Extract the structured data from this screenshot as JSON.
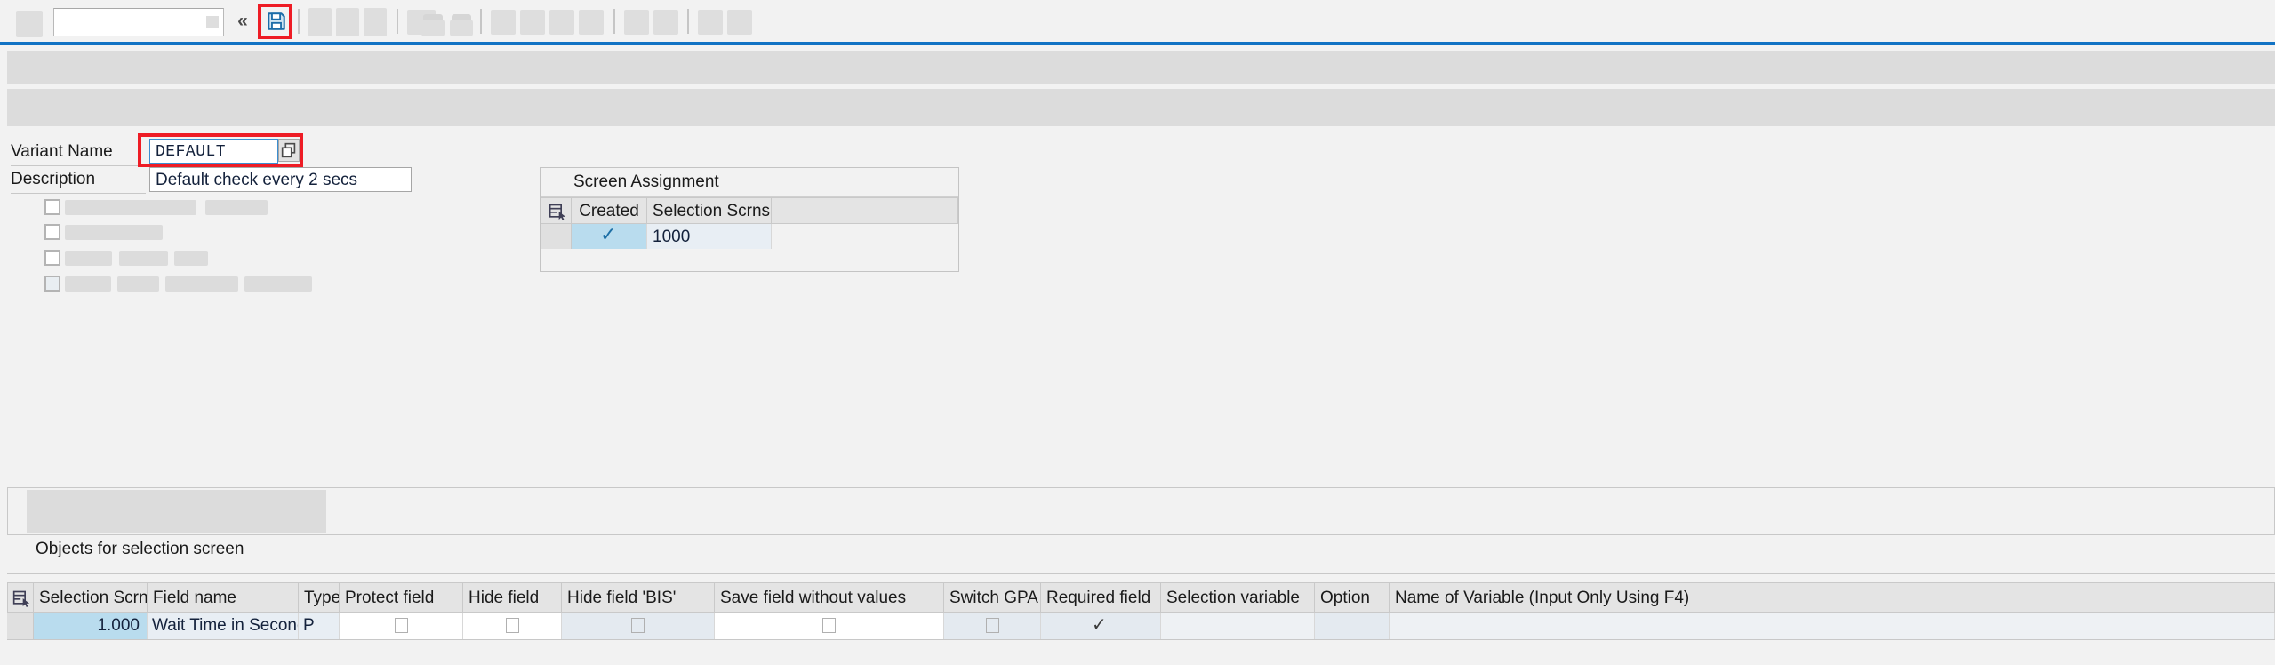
{
  "toolbar": {
    "command_field_value": "",
    "command_field_placeholder": "",
    "back_chevrons": "«",
    "save_icon": "save-icon",
    "save_tooltip": "Save"
  },
  "form": {
    "variant_name_label": "Variant Name",
    "variant_name_value": "DEFAULT",
    "description_label": "Description",
    "description_value": "Default check every 2 secs",
    "f4_icon": "search-help-icon"
  },
  "screen_assignment": {
    "title": "Screen Assignment",
    "row_selector_icon": "table-select-icon",
    "columns": [
      "Created",
      "Selection Scrns"
    ],
    "rows": [
      {
        "created": true,
        "selection_scrns": "1000"
      }
    ]
  },
  "objects_section": {
    "label": "Objects for selection screen",
    "row_selector_icon": "table-select-icon",
    "columns": [
      "Selection Scrns",
      "Field name",
      "Type",
      "Protect field",
      "Hide field",
      "Hide field 'BIS'",
      "Save field without values",
      "Switch GPA ...",
      "Required field",
      "Selection variable",
      "Option",
      "Name of Variable (Input Only Using F4)"
    ],
    "rows": [
      {
        "selection_scrns": "1.000",
        "field_name": "Wait Time in Seconds",
        "type": "P",
        "protect_field": false,
        "hide_field": false,
        "hide_field_bis": false,
        "save_field_without_values": false,
        "switch_gpa": false,
        "required_field": true,
        "selection_variable": "",
        "option": "",
        "name_of_variable": ""
      }
    ]
  },
  "colors": {
    "highlight_red": "#ee1c25",
    "accent_blue": "#1273c4",
    "selected_cell_blue": "#b9dcee",
    "toolbar_bg": "#f2f2f2"
  }
}
